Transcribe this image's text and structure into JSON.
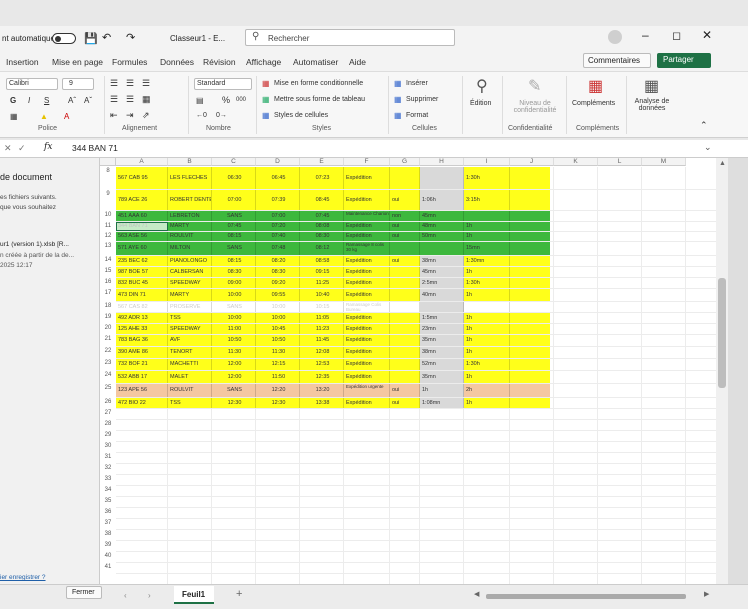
{
  "window": {
    "autosave_label": "nt automatique",
    "title": "Classeur1 - E...",
    "search_placeholder": "Rechercher",
    "comments_label": "Commentaires",
    "share_label": "Partager"
  },
  "menu": [
    "Insertion",
    "Mise en page",
    "Formules",
    "Données",
    "Révision",
    "Affichage",
    "Automatiser",
    "Aide"
  ],
  "ribbon": {
    "font_name": "Calibri",
    "font_size": "9",
    "number_format": "Standard",
    "conditional": "Mise en forme conditionnelle",
    "table_format": "Mettre sous forme de tableau",
    "cell_styles": "Styles de cellules",
    "insert": "Insérer",
    "delete": "Supprimer",
    "format": "Format",
    "edition": "Édition",
    "confidentiality": "Niveau de confidentialité",
    "addins": "Compléments",
    "analyze": "Analyse de données",
    "groups": {
      "police": "Police",
      "alignment": "Alignement",
      "number": "Nombre",
      "styles": "Styles",
      "cells": "Cellules",
      "confid": "Confidentialité",
      "addins": "Compléments"
    }
  },
  "formula": {
    "fx": "fx",
    "value": "344 BAN 71"
  },
  "leftpane": {
    "title": "de document",
    "line1": "es fichiers suivants.",
    "line2": "que vous souhaitez",
    "file1": "ur1 (version 1).xlsb [R...",
    "file2": "n créée à partir de la de...",
    "file3": "2025 12:17",
    "footer": "ier enregistrer ?",
    "close": "Fermer"
  },
  "columns": [
    "A",
    "B",
    "C",
    "D",
    "E",
    "F",
    "G",
    "H",
    "I",
    "J",
    "K",
    "L",
    "M"
  ],
  "rows": [
    {
      "n": "8",
      "h": 22,
      "bg": "#ffff1a",
      "c": [
        "567 CAB 95",
        "LES FLECHES",
        "06:30",
        "06:45",
        "07:23",
        "Expédition",
        "",
        "",
        "1:30h"
      ]
    },
    {
      "n": "9",
      "h": 20,
      "bg": "#ffff1a",
      "c": [
        "789 ACE 26",
        "ROBERT DENTE",
        "07:00",
        "07:39",
        "08:45",
        "Expédition",
        "oui",
        "1:06h",
        "3:15h"
      ]
    },
    {
      "n": "10",
      "h": 10,
      "bg": "#3db83d",
      "c": [
        "451 AAA 60",
        "LEBRETON",
        "SANS",
        "07:00",
        "07:45",
        "Maintenance Charion",
        "non",
        "45mn",
        ""
      ]
    },
    {
      "n": "11",
      "h": 9,
      "bg": "#3db83d",
      "c": [
        "344 BAN 71",
        "MARTY",
        "07:45",
        "07:20",
        "08:08",
        "Expédition",
        "oui",
        "48mn",
        "1h"
      ]
    },
    {
      "n": "12",
      "h": 9,
      "bg": "#3db83d",
      "c": [
        "563 ASE 56",
        "ROULVIT",
        "08:15",
        "07:40",
        "08:30",
        "Expédition",
        "oui",
        "50mn",
        "1h"
      ]
    },
    {
      "n": "13",
      "h": 13,
      "bg": "#3db83d",
      "c": [
        "571 AYE 60",
        "MILTON",
        "SANS",
        "07:48",
        "08:12",
        "Ramassage 8 colis 30 kg",
        "",
        "",
        "15mn"
      ]
    },
    {
      "n": "14",
      "h": 10,
      "bg": "#ffff1a",
      "c": [
        "235 BEC 62",
        "PIANOLONGO",
        "08:15",
        "08:20",
        "08:58",
        "Expédition",
        "oui",
        "38mn",
        "1:30mn"
      ]
    },
    {
      "n": "15",
      "h": 10,
      "bg": "#ffff1a",
      "c": [
        "987 BOE 57",
        "CALBERSAN",
        "08:30",
        "08:30",
        "09:15",
        "Expédition",
        "",
        "45mn",
        "1h"
      ]
    },
    {
      "n": "16",
      "h": 10,
      "bg": "#ffff1a",
      "c": [
        "832 BUC 45",
        "SPEEDWAY",
        "09:00",
        "09:20",
        "11:25",
        "Expédition",
        "",
        "2:5mn",
        "1:30h"
      ]
    },
    {
      "n": "17",
      "h": 12,
      "bg": "#ffff1a",
      "c": [
        "473 DIN 71",
        "MARTY",
        "10:00",
        "09:55",
        "10:40",
        "Expédition",
        "",
        "40mn",
        "1h"
      ]
    },
    {
      "n": "18",
      "h": 10,
      "bg": "#ffffff",
      "c": [
        "567 CAS 82",
        "PROSERVE",
        "SANS",
        "10:00",
        "10:15",
        "Ramassage Colis Bureau",
        "",
        "",
        ""
      ]
    },
    {
      "n": "19",
      "h": 10,
      "bg": "#ffff1a",
      "c": [
        "492 ADR 13",
        "TSS",
        "10:00",
        "10:00",
        "11:05",
        "Expédition",
        "",
        "1:5mn",
        "1h"
      ]
    },
    {
      "n": "20",
      "h": 10,
      "bg": "#ffff1a",
      "c": [
        "125 AHE 33",
        "SPEEDWAY",
        "11:00",
        "10:45",
        "11:23",
        "Expédition",
        "",
        "23mn",
        "1h"
      ]
    },
    {
      "n": "21",
      "h": 11,
      "bg": "#ffff1a",
      "c": [
        "783 BAG 36",
        "AVF",
        "10:50",
        "10:50",
        "11:45",
        "Expédition",
        "",
        "35mn",
        "1h"
      ]
    },
    {
      "n": "22",
      "h": 11,
      "bg": "#ffff1a",
      "c": [
        "390 AME 86",
        "TENORT",
        "11:30",
        "11:30",
        "12:08",
        "Expédition",
        "",
        "38mn",
        "1h"
      ]
    },
    {
      "n": "23",
      "h": 11,
      "bg": "#ffff1a",
      "c": [
        "732 BOF 21",
        "MACHETTI",
        "12:00",
        "12:15",
        "12:53",
        "Expédition",
        "",
        "52mn",
        "1:30h"
      ]
    },
    {
      "n": "24",
      "h": 12,
      "bg": "#ffff1a",
      "c": [
        "532 ABB 17",
        "MALET",
        "12:00",
        "11:50",
        "12:35",
        "Expédition",
        "",
        "35mn",
        "1h"
      ]
    },
    {
      "n": "25",
      "h": 13,
      "bg": "#f4c7a1",
      "c": [
        "123 APE 56",
        "ROULVIT",
        "SANS",
        "12:20",
        "13:20",
        "Expédition urgente",
        "oui",
        "1h",
        "2h"
      ]
    },
    {
      "n": "26",
      "h": 10,
      "bg": "#ffff1a",
      "c": [
        "472 BIO 22",
        "TSS",
        "12:30",
        "12:30",
        "13:38",
        "Expédition",
        "oui",
        "1:08mn",
        "1h"
      ]
    }
  ],
  "empty_rows": [
    "27",
    "28",
    "29",
    "30",
    "31",
    "32",
    "33",
    "34",
    "35",
    "36",
    "37",
    "38",
    "39",
    "40",
    "41"
  ],
  "sheet_tab": "Feuil1"
}
